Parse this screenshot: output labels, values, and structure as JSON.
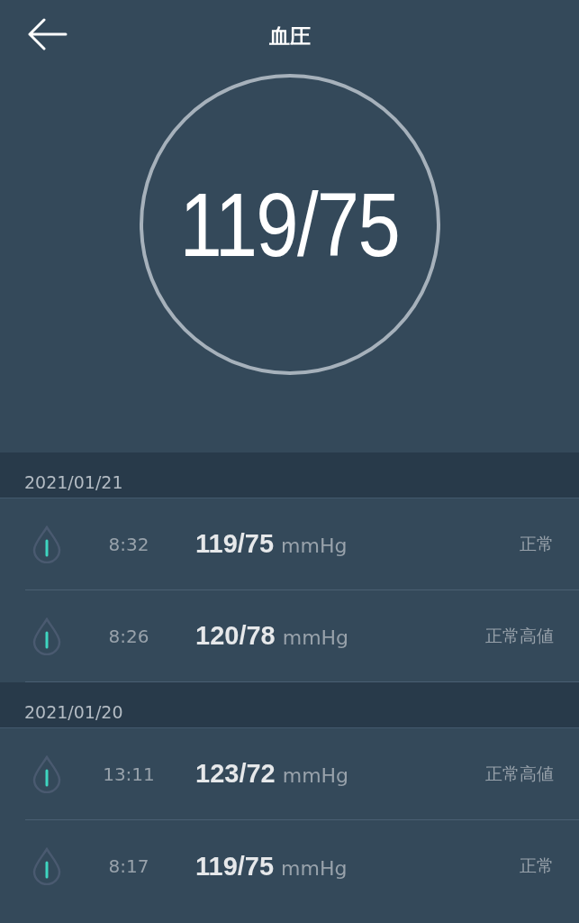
{
  "header": {
    "title": "血圧"
  },
  "current": {
    "reading": "119/75"
  },
  "groups": [
    {
      "date": "2021/01/21",
      "records": [
        {
          "time": "8:32",
          "value": "119/75",
          "unit": "mmHg",
          "status": "正常"
        },
        {
          "time": "8:26",
          "value": "120/78",
          "unit": "mmHg",
          "status": "正常高値"
        }
      ]
    },
    {
      "date": "2021/01/20",
      "records": [
        {
          "time": "13:11",
          "value": "123/72",
          "unit": "mmHg",
          "status": "正常高値"
        },
        {
          "time": "8:17",
          "value": "119/75",
          "unit": "mmHg",
          "status": "正常"
        }
      ]
    }
  ]
}
